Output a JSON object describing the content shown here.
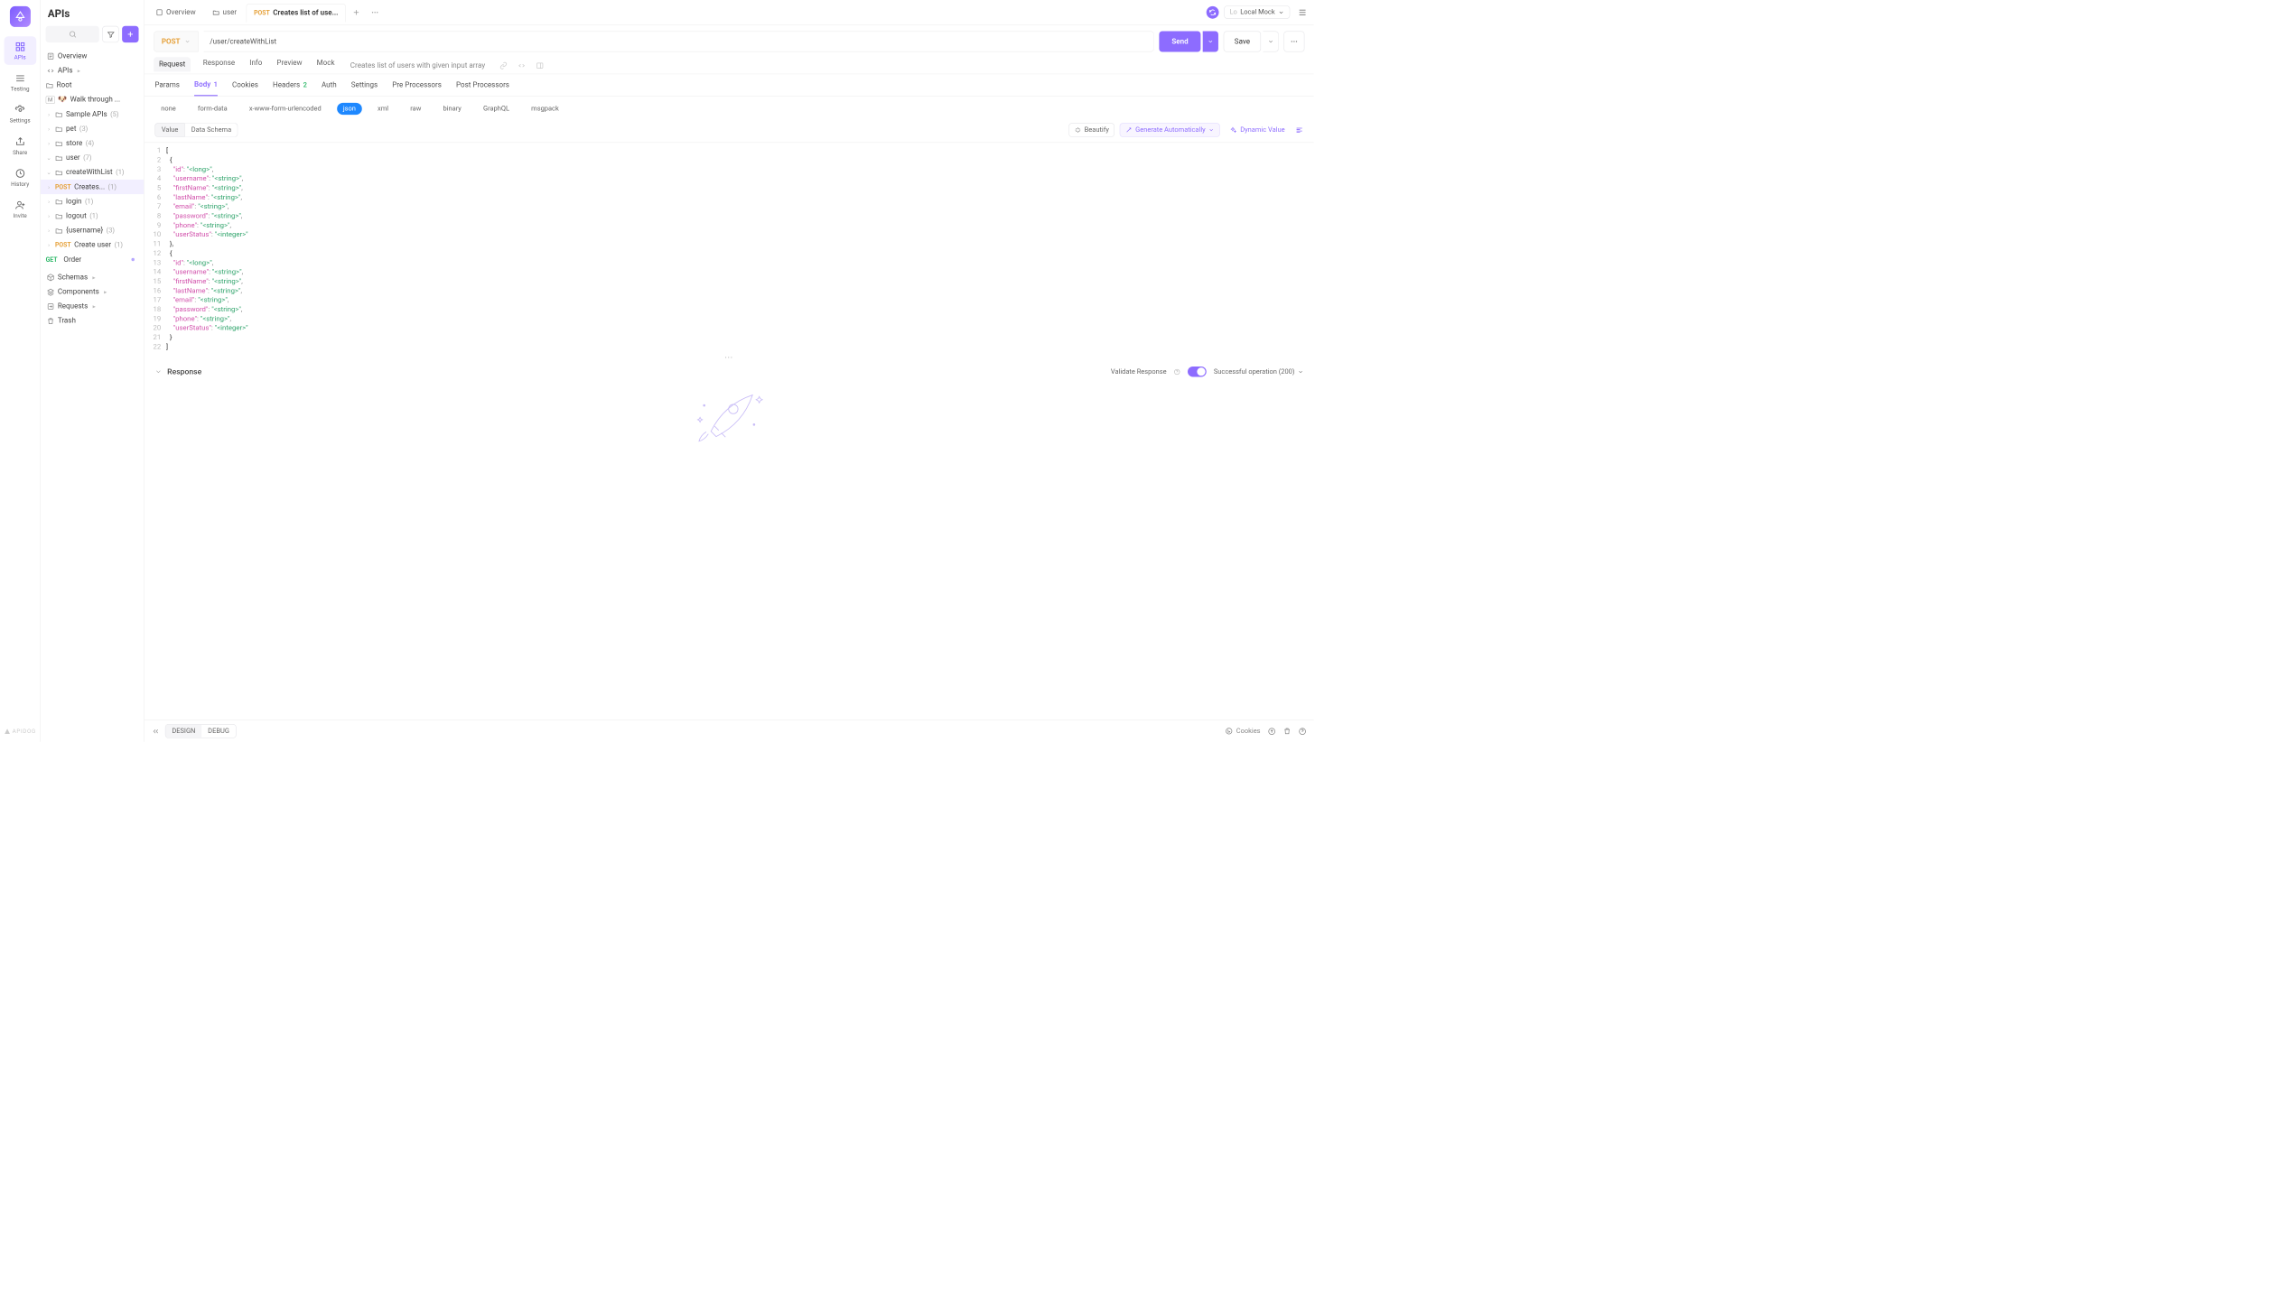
{
  "rail": {
    "items": [
      "APIs",
      "Testing",
      "Settings",
      "Share",
      "History",
      "Invite"
    ]
  },
  "sidebar": {
    "title": "APIs",
    "overview": "Overview",
    "apis_label": "APIs",
    "root": "Root",
    "walk": "Walk through ...",
    "sample": "Sample APIs",
    "sample_count": "(5)",
    "pet": "pet",
    "pet_count": "(3)",
    "store": "store",
    "store_count": "(4)",
    "user": "user",
    "user_count": "(7)",
    "cwl": "createWithList",
    "cwl_count": "(1)",
    "cwl_post_method": "POST",
    "cwl_post_label": "Creates...",
    "cwl_post_count": "(1)",
    "login": "login",
    "login_count": "(1)",
    "logout": "logout",
    "logout_count": "(1)",
    "uname": "{username}",
    "uname_count": "(3)",
    "cu_method": "POST",
    "cu_label": "Create user",
    "cu_count": "(1)",
    "order_method": "GET",
    "order_label": "Order",
    "schemas": "Schemas",
    "components": "Components",
    "requests": "Requests",
    "trash": "Trash"
  },
  "tabs": {
    "overview": "Overview",
    "user": "user",
    "active_method": "POST",
    "active_label": "Creates list of use..."
  },
  "env": {
    "prefix": "Lo",
    "name": "Local Mock"
  },
  "request": {
    "method": "POST",
    "url": "/user/createWithList",
    "send": "Send",
    "save": "Save"
  },
  "subtabs": {
    "request": "Request",
    "response": "Response",
    "info": "Info",
    "preview": "Preview",
    "mock": "Mock",
    "desc": "Creates list of users with given input array"
  },
  "innertabs": {
    "params": "Params",
    "body": "Body",
    "body_badge": "1",
    "cookies": "Cookies",
    "headers": "Headers",
    "headers_badge": "2",
    "auth": "Auth",
    "settings": "Settings",
    "pre": "Pre Processors",
    "post": "Post Processors"
  },
  "bodytypes": [
    "none",
    "form-data",
    "x-www-form-urlencoded",
    "json",
    "xml",
    "raw",
    "binary",
    "GraphQL",
    "msgpack"
  ],
  "valrow": {
    "value": "Value",
    "schema": "Data Schema",
    "beautify": "Beautify",
    "gen": "Generate Automatically",
    "dyn": "Dynamic Value"
  },
  "code": {
    "lines": [
      {
        "n": 1,
        "t": "["
      },
      {
        "n": 2,
        "t": "  {"
      },
      {
        "n": 3,
        "k": "id",
        "v": "<long>",
        "comma": true,
        "ind": 2
      },
      {
        "n": 4,
        "k": "username",
        "v": "<string>",
        "comma": true,
        "ind": 2
      },
      {
        "n": 5,
        "k": "firstName",
        "v": "<string>",
        "comma": true,
        "ind": 2
      },
      {
        "n": 6,
        "k": "lastName",
        "v": "<string>",
        "comma": true,
        "ind": 2
      },
      {
        "n": 7,
        "k": "email",
        "v": "<string>",
        "comma": true,
        "ind": 2
      },
      {
        "n": 8,
        "k": "password",
        "v": "<string>",
        "comma": true,
        "ind": 2
      },
      {
        "n": 9,
        "k": "phone",
        "v": "<string>",
        "comma": true,
        "ind": 2
      },
      {
        "n": 10,
        "k": "userStatus",
        "v": "<integer>",
        "comma": false,
        "ind": 2
      },
      {
        "n": 11,
        "t": "  },"
      },
      {
        "n": 12,
        "t": "  {"
      },
      {
        "n": 13,
        "k": "id",
        "v": "<long>",
        "comma": true,
        "ind": 2
      },
      {
        "n": 14,
        "k": "username",
        "v": "<string>",
        "comma": true,
        "ind": 2
      },
      {
        "n": 15,
        "k": "firstName",
        "v": "<string>",
        "comma": true,
        "ind": 2
      },
      {
        "n": 16,
        "k": "lastName",
        "v": "<string>",
        "comma": true,
        "ind": 2
      },
      {
        "n": 17,
        "k": "email",
        "v": "<string>",
        "comma": true,
        "ind": 2
      },
      {
        "n": 18,
        "k": "password",
        "v": "<string>",
        "comma": true,
        "ind": 2
      },
      {
        "n": 19,
        "k": "phone",
        "v": "<string>",
        "comma": true,
        "ind": 2
      },
      {
        "n": 20,
        "k": "userStatus",
        "v": "<integer>",
        "comma": false,
        "ind": 2
      },
      {
        "n": 21,
        "t": "  }"
      },
      {
        "n": 22,
        "t": "]"
      }
    ]
  },
  "response": {
    "label": "Response",
    "validate": "Validate Response",
    "status": "Successful operation (200)"
  },
  "footer": {
    "design": "DESIGN",
    "debug": "DEBUG",
    "cookies": "Cookies"
  },
  "brand": "APIDOG"
}
